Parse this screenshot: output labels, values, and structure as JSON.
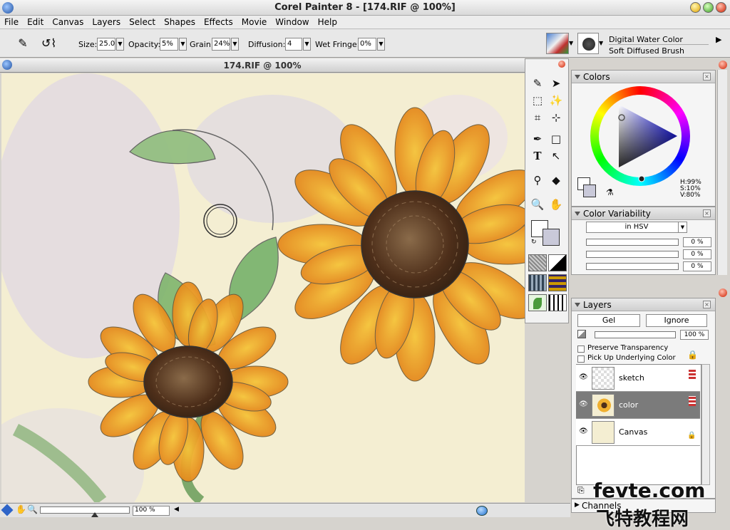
{
  "app": {
    "title": "Corel Painter 8 - [174.RIF @ 100%]"
  },
  "menu": [
    "File",
    "Edit",
    "Canvas",
    "Layers",
    "Select",
    "Shapes",
    "Effects",
    "Movie",
    "Window",
    "Help"
  ],
  "property_bar": {
    "size_label": "Size:",
    "size_value": "25.0",
    "opacity_label": "Opacity:",
    "opacity_value": "5%",
    "grain_label": "Grain:",
    "grain_value": "24%",
    "diffusion_label": "Diffusion:",
    "diffusion_value": "4",
    "wet_fringe_label": "Wet Fringe:",
    "wet_fringe_value": "0%",
    "brush_category": "Digital Water Color",
    "brush_variant": "Soft Diffused Brush"
  },
  "document": {
    "title": "174.RIF @ 100%",
    "zoom": "100 %"
  },
  "colors_panel": {
    "title": "Colors",
    "h": "H:99%",
    "s": "S:10%",
    "v": "V:80%"
  },
  "color_variability": {
    "title": "Color Variability",
    "mode": "in HSV",
    "values": [
      "0 %",
      "0 %",
      "0 %"
    ]
  },
  "layers_panel": {
    "title": "Layers",
    "composite_method": "Gel",
    "composite_depth": "Ignore",
    "opacity": "100 %",
    "preserve_transparency": "Preserve Transparency",
    "pick_up_underlying": "Pick Up Underlying Color",
    "layers": [
      {
        "name": "sketch"
      },
      {
        "name": "color"
      },
      {
        "name": "Canvas"
      }
    ]
  },
  "channels_panel": {
    "title": "Channels"
  },
  "watermark": {
    "latin": "fevte.com",
    "cjk": "飞特教程网"
  },
  "colors": {
    "selected_layer": "#7b7b7b",
    "accent": "#2e64c8"
  }
}
